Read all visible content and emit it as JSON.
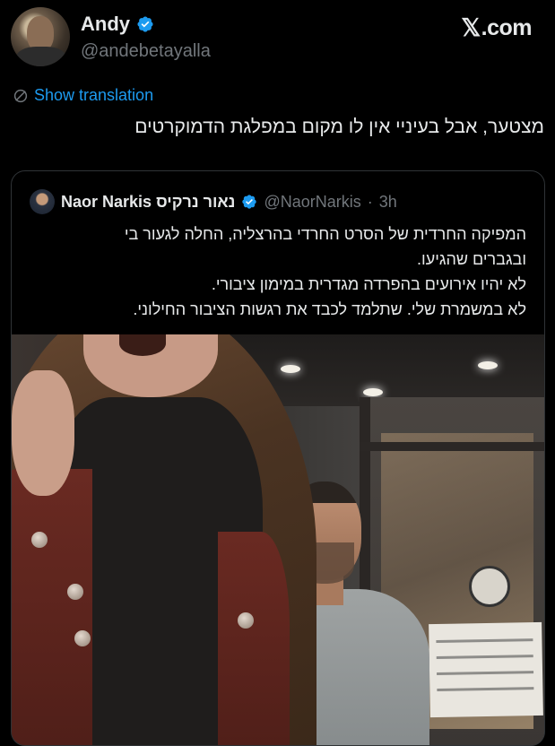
{
  "author": {
    "name": "Andy",
    "handle": "@andebetayalla"
  },
  "brand": {
    "label": ".com",
    "x_glyph": "𝕏",
    "accent": "#1d9bf0"
  },
  "translate": {
    "label": "Show translation",
    "icon": "globe-translate-icon"
  },
  "tweet": {
    "text": "מצטער, אבל בעיניי אין לו מקום במפלגת הדמוקרטים"
  },
  "quote": {
    "name": "Naor Narkis נאור נרקיס",
    "handle": "@NaorNarkis",
    "separator": "·",
    "time": "3h",
    "lines": [
      "המפיקה החרדית של הסרט החרדי בהרצליה, החלה לגעור בי",
      "ובגברים שהגיעו.",
      "לא יהיו אירועים בהפרדה מגדרית במימון ציבורי.",
      "לא במשמרת שלי. שתלמד לכבד את רגשות הציבור החילוני."
    ]
  },
  "colors": {
    "background": "#000000",
    "text": "#e7e9ea",
    "muted": "#71767b",
    "verified": "#1d9bf0",
    "border": "#2f3336"
  }
}
